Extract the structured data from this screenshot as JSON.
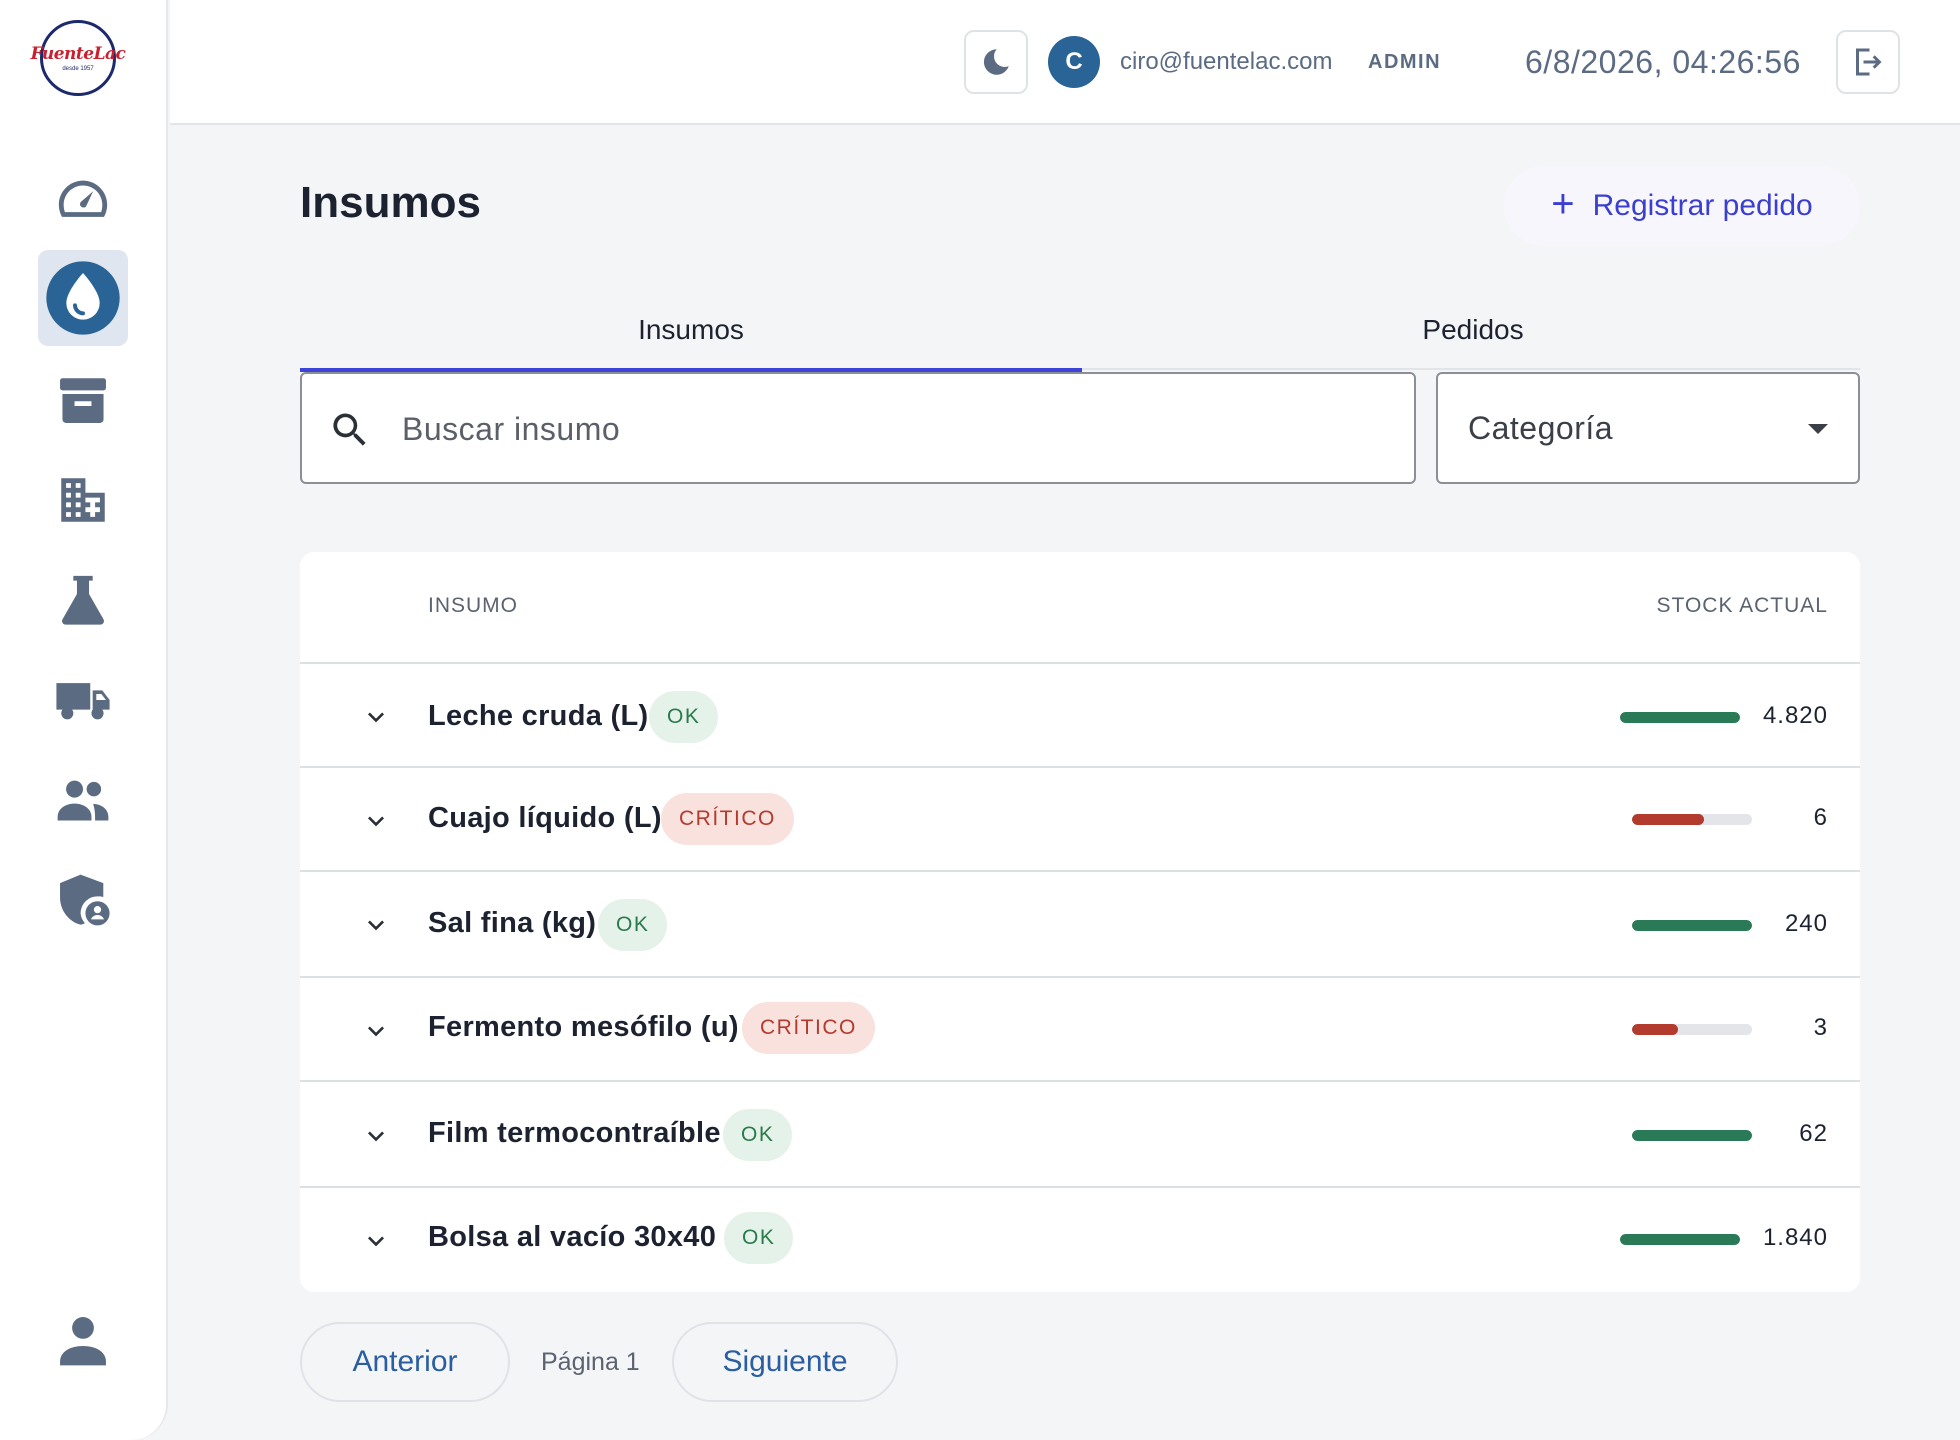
{
  "logo": {
    "text": "FuenteLac",
    "sub": "desde 1957"
  },
  "sidebar": {
    "items": [
      {
        "name": "dashboard",
        "icon": "speedometer-icon"
      },
      {
        "name": "insumos",
        "icon": "water-drop-icon",
        "active": true
      },
      {
        "name": "archivo",
        "icon": "archive-box-icon"
      },
      {
        "name": "empresas",
        "icon": "building-icon"
      },
      {
        "name": "laboratorio",
        "icon": "flask-icon"
      },
      {
        "name": "transporte",
        "icon": "truck-icon"
      },
      {
        "name": "usuarios",
        "icon": "people-icon"
      },
      {
        "name": "seguridad",
        "icon": "shield-user-icon"
      }
    ],
    "profile_icon": "person-icon"
  },
  "header": {
    "avatar_letter": "C",
    "email": "ciro@fuentelac.com",
    "role": "ADMIN",
    "datetime": "6/8/2026, 04:26:56",
    "theme_icon": "moon-icon",
    "logout_icon": "logout-icon"
  },
  "page": {
    "title": "Insumos",
    "primary_action": "Registrar pedido"
  },
  "tabs": [
    {
      "label": "Insumos",
      "active": true
    },
    {
      "label": "Pedidos",
      "active": false
    }
  ],
  "filters": {
    "search_placeholder": "Buscar insumo",
    "category_label": "Categoría"
  },
  "table": {
    "columns": {
      "insumo": "INSUMO",
      "stock": "STOCK ACTUAL"
    },
    "rows": [
      {
        "name": "Leche cruda (L)",
        "status": "OK",
        "stock": "4.820",
        "level": 1.0
      },
      {
        "name": "Cuajo líquido (L)",
        "status": "CRÍTICO",
        "stock": "6",
        "level": 0.6
      },
      {
        "name": "Sal fina (kg)",
        "status": "OK",
        "stock": "240",
        "level": 1.0
      },
      {
        "name": "Fermento mesófilo (u)",
        "status": "CRÍTICO",
        "stock": "3",
        "level": 0.38
      },
      {
        "name": "Film termocontraíble",
        "status": "OK",
        "stock": "62",
        "level": 1.0
      },
      {
        "name": "Bolsa al vacío 30x40",
        "status": "OK",
        "stock": "1.840",
        "level": 1.0
      }
    ]
  },
  "pagination": {
    "prev": "Anterior",
    "page_label": "Página 1",
    "next": "Siguiente"
  },
  "colors": {
    "accent": "#3b44d6",
    "ok_bar": "#2a7a57",
    "critical_bar": "#b23b2e",
    "avatar": "#2a6496",
    "icon": "#5b6b82"
  }
}
